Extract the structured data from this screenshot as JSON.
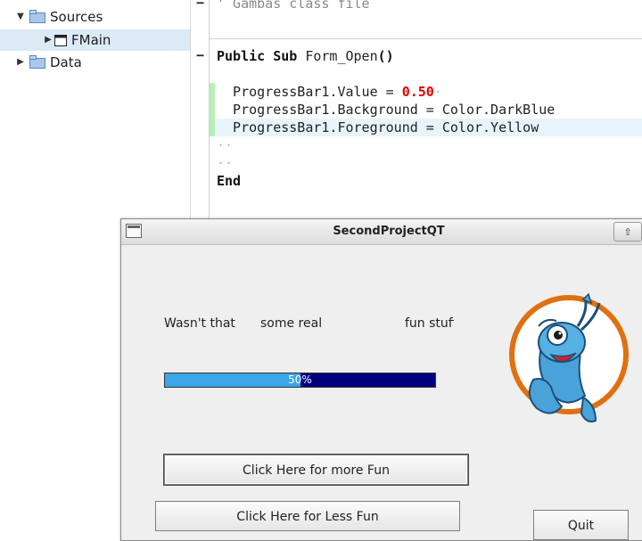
{
  "tree": {
    "items": [
      {
        "label": "Sources",
        "expanded": true
      },
      {
        "label": "FMain",
        "selected": true
      },
      {
        "label": "Data",
        "expanded": false
      }
    ]
  },
  "editor": {
    "comment_line": "' Gambas class file",
    "sub_keyword": "Public Sub",
    "sub_name": "Form_Open",
    "sub_parens": "()",
    "line1_prefix": "  ProgressBar1.Value = ",
    "line1_value": "0.50",
    "line2": "  ProgressBar1.Background = Color.DarkBlue",
    "line3": "  ProgressBar1.Foreground = Color.Yellow",
    "empty_dots": "··",
    "end_keyword": "End",
    "fold_marker": "−"
  },
  "window": {
    "title": "SecondProjectQT",
    "max_icon": "⇧",
    "label1": "Wasn't that",
    "label2": "some real",
    "label3": "fun stuff",
    "progress": {
      "value": 0.5,
      "text": "50%",
      "fill_color": "#3aa6e8",
      "track_color": "#00007f"
    },
    "btn_more": "Click Here for more Fun",
    "btn_less": "Click Here for Less Fun",
    "btn_quit": "Quit",
    "mascot_icon": "gambas-shrimp-mascot"
  }
}
